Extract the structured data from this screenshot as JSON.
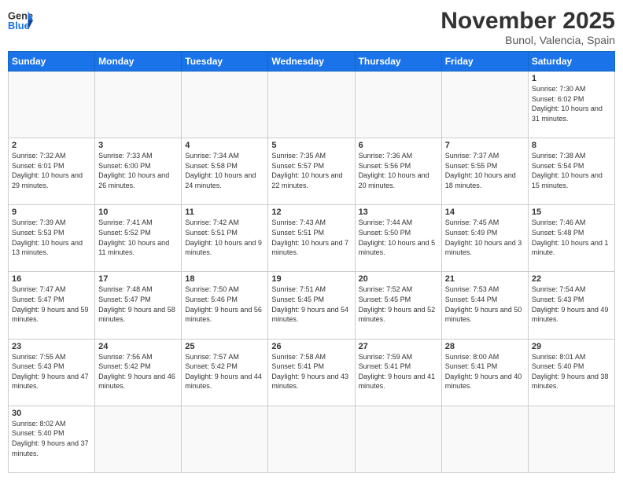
{
  "header": {
    "logo_general": "General",
    "logo_blue": "Blue",
    "month_title": "November 2025",
    "location": "Bunol, Valencia, Spain"
  },
  "days_of_week": [
    "Sunday",
    "Monday",
    "Tuesday",
    "Wednesday",
    "Thursday",
    "Friday",
    "Saturday"
  ],
  "weeks": [
    [
      {
        "day": "",
        "empty": true
      },
      {
        "day": "",
        "empty": true
      },
      {
        "day": "",
        "empty": true
      },
      {
        "day": "",
        "empty": true
      },
      {
        "day": "",
        "empty": true
      },
      {
        "day": "",
        "empty": true
      },
      {
        "day": "1",
        "sunrise": "7:30 AM",
        "sunset": "6:02 PM",
        "daylight": "10 hours and 31 minutes."
      }
    ],
    [
      {
        "day": "2",
        "sunrise": "7:32 AM",
        "sunset": "6:01 PM",
        "daylight": "10 hours and 29 minutes."
      },
      {
        "day": "3",
        "sunrise": "7:33 AM",
        "sunset": "6:00 PM",
        "daylight": "10 hours and 26 minutes."
      },
      {
        "day": "4",
        "sunrise": "7:34 AM",
        "sunset": "5:58 PM",
        "daylight": "10 hours and 24 minutes."
      },
      {
        "day": "5",
        "sunrise": "7:35 AM",
        "sunset": "5:57 PM",
        "daylight": "10 hours and 22 minutes."
      },
      {
        "day": "6",
        "sunrise": "7:36 AM",
        "sunset": "5:56 PM",
        "daylight": "10 hours and 20 minutes."
      },
      {
        "day": "7",
        "sunrise": "7:37 AM",
        "sunset": "5:55 PM",
        "daylight": "10 hours and 18 minutes."
      },
      {
        "day": "8",
        "sunrise": "7:38 AM",
        "sunset": "5:54 PM",
        "daylight": "10 hours and 15 minutes."
      }
    ],
    [
      {
        "day": "9",
        "sunrise": "7:39 AM",
        "sunset": "5:53 PM",
        "daylight": "10 hours and 13 minutes."
      },
      {
        "day": "10",
        "sunrise": "7:41 AM",
        "sunset": "5:52 PM",
        "daylight": "10 hours and 11 minutes."
      },
      {
        "day": "11",
        "sunrise": "7:42 AM",
        "sunset": "5:51 PM",
        "daylight": "10 hours and 9 minutes."
      },
      {
        "day": "12",
        "sunrise": "7:43 AM",
        "sunset": "5:51 PM",
        "daylight": "10 hours and 7 minutes."
      },
      {
        "day": "13",
        "sunrise": "7:44 AM",
        "sunset": "5:50 PM",
        "daylight": "10 hours and 5 minutes."
      },
      {
        "day": "14",
        "sunrise": "7:45 AM",
        "sunset": "5:49 PM",
        "daylight": "10 hours and 3 minutes."
      },
      {
        "day": "15",
        "sunrise": "7:46 AM",
        "sunset": "5:48 PM",
        "daylight": "10 hours and 1 minute."
      }
    ],
    [
      {
        "day": "16",
        "sunrise": "7:47 AM",
        "sunset": "5:47 PM",
        "daylight": "9 hours and 59 minutes."
      },
      {
        "day": "17",
        "sunrise": "7:48 AM",
        "sunset": "5:47 PM",
        "daylight": "9 hours and 58 minutes."
      },
      {
        "day": "18",
        "sunrise": "7:50 AM",
        "sunset": "5:46 PM",
        "daylight": "9 hours and 56 minutes."
      },
      {
        "day": "19",
        "sunrise": "7:51 AM",
        "sunset": "5:45 PM",
        "daylight": "9 hours and 54 minutes."
      },
      {
        "day": "20",
        "sunrise": "7:52 AM",
        "sunset": "5:45 PM",
        "daylight": "9 hours and 52 minutes."
      },
      {
        "day": "21",
        "sunrise": "7:53 AM",
        "sunset": "5:44 PM",
        "daylight": "9 hours and 50 minutes."
      },
      {
        "day": "22",
        "sunrise": "7:54 AM",
        "sunset": "5:43 PM",
        "daylight": "9 hours and 49 minutes."
      }
    ],
    [
      {
        "day": "23",
        "sunrise": "7:55 AM",
        "sunset": "5:43 PM",
        "daylight": "9 hours and 47 minutes."
      },
      {
        "day": "24",
        "sunrise": "7:56 AM",
        "sunset": "5:42 PM",
        "daylight": "9 hours and 46 minutes."
      },
      {
        "day": "25",
        "sunrise": "7:57 AM",
        "sunset": "5:42 PM",
        "daylight": "9 hours and 44 minutes."
      },
      {
        "day": "26",
        "sunrise": "7:58 AM",
        "sunset": "5:41 PM",
        "daylight": "9 hours and 43 minutes."
      },
      {
        "day": "27",
        "sunrise": "7:59 AM",
        "sunset": "5:41 PM",
        "daylight": "9 hours and 41 minutes."
      },
      {
        "day": "28",
        "sunrise": "8:00 AM",
        "sunset": "5:41 PM",
        "daylight": "9 hours and 40 minutes."
      },
      {
        "day": "29",
        "sunrise": "8:01 AM",
        "sunset": "5:40 PM",
        "daylight": "9 hours and 38 minutes."
      }
    ],
    [
      {
        "day": "30",
        "sunrise": "8:02 AM",
        "sunset": "5:40 PM",
        "daylight": "9 hours and 37 minutes."
      },
      {
        "day": "",
        "empty": true
      },
      {
        "day": "",
        "empty": true
      },
      {
        "day": "",
        "empty": true
      },
      {
        "day": "",
        "empty": true
      },
      {
        "day": "",
        "empty": true
      },
      {
        "day": "",
        "empty": true
      }
    ]
  ]
}
